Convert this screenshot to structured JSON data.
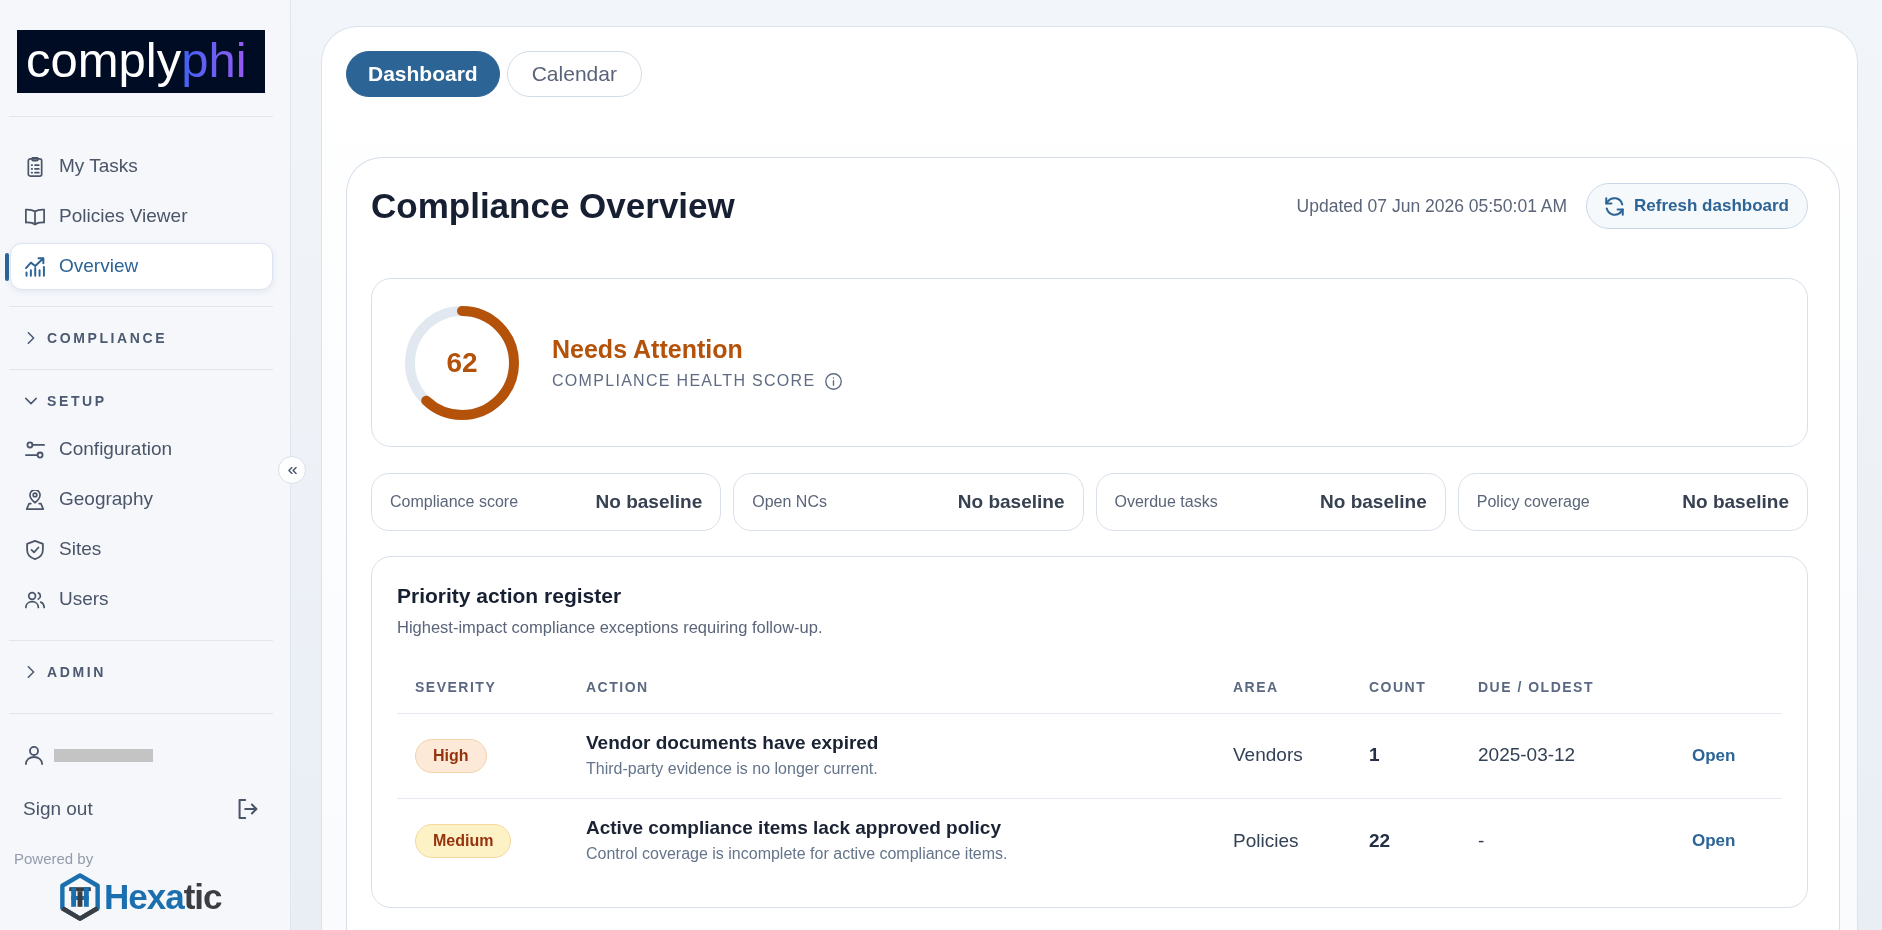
{
  "sidebar": {
    "logo": {
      "word": "comply",
      "accent": "phi"
    },
    "nav": [
      {
        "label": "My Tasks",
        "selected": false
      },
      {
        "label": "Policies Viewer",
        "selected": false
      },
      {
        "label": "Overview",
        "selected": true
      }
    ],
    "sections": [
      {
        "label": "COMPLIANCE",
        "expanded": false
      },
      {
        "label": "SETUP",
        "expanded": true,
        "items": [
          {
            "label": "Configuration",
            "selected": false
          },
          {
            "label": "Geography",
            "selected": false
          },
          {
            "label": "Sites",
            "selected": false
          },
          {
            "label": "Users",
            "selected": false
          }
        ]
      },
      {
        "label": "ADMIN",
        "expanded": false
      }
    ],
    "sign_out": "Sign out",
    "powered_by": {
      "label": "Powered by",
      "brand": "Hexa",
      "brand_tail": "tic"
    }
  },
  "tabs": [
    {
      "label": "Dashboard",
      "selected": true
    },
    {
      "label": "Calendar",
      "selected": false
    }
  ],
  "overview": {
    "title": "Compliance Overview",
    "updated": "Updated 07 Jun 2026 05:50:01 AM",
    "refresh_button": "Refresh dashboard"
  },
  "health": {
    "score": "62",
    "level": 0.62,
    "status": "Needs Attention",
    "caption": "COMPLIANCE HEALTH SCORE"
  },
  "kpis": [
    {
      "label": "Compliance score",
      "value": "No baseline"
    },
    {
      "label": "Open NCs",
      "value": "No baseline"
    },
    {
      "label": "Overdue tasks",
      "value": "No baseline"
    },
    {
      "label": "Policy coverage",
      "value": "No baseline"
    }
  ],
  "register": {
    "title": "Priority action register",
    "subtitle": "Highest-impact compliance exceptions requiring follow-up.",
    "columns": [
      "SEVERITY",
      "ACTION",
      "AREA",
      "COUNT",
      "DUE / OLDEST"
    ],
    "rows": [
      {
        "severity": "High",
        "color": "#fde9d8",
        "action": "Vendor documents have expired",
        "detail": "Third-party evidence is no longer current.",
        "area": "Vendors",
        "count": "1",
        "due": "2025-03-12",
        "link": "Open"
      },
      {
        "severity": "Medium",
        "color": "#fdf2c6",
        "action": "Active compliance items lack approved policy",
        "detail": "Control coverage is incomplete for active compliance items.",
        "area": "Policies",
        "count": "22",
        "due": "-",
        "link": "Open"
      }
    ]
  }
}
